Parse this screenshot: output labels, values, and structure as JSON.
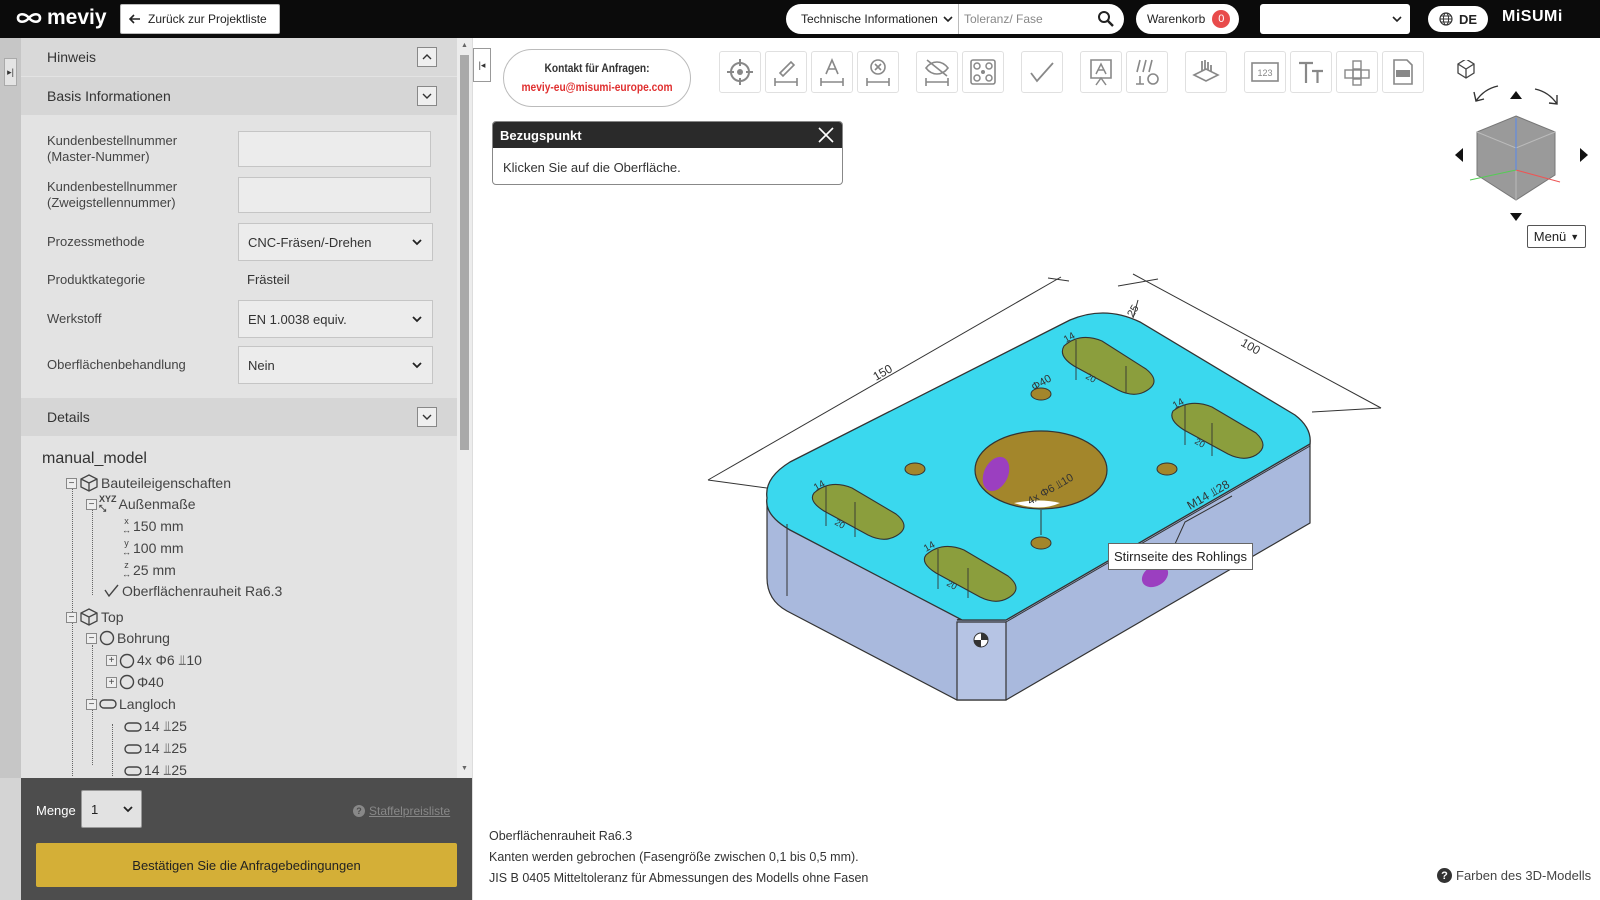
{
  "header": {
    "logo_text": "meviy",
    "back_button": "Zurück zur Projektliste",
    "search_category": "Technische Informationen",
    "search_placeholder": "Toleranz/ Fase",
    "cart_label": "Warenkorb",
    "cart_count": "0",
    "language": "DE",
    "brand": "MiSUMi"
  },
  "sidebar": {
    "hint_title": "Hinweis",
    "basis_title": "Basis Informationen",
    "fields": {
      "order_master_l1": "Kundenbestellnummer",
      "order_master_l2": "(Master-Nummer)",
      "order_branch_l1": "Kundenbestellnummer",
      "order_branch_l2": "(Zweigstellennummer)",
      "process_label": "Prozessmethode",
      "process_value": "CNC-Fräsen/-Drehen",
      "category_label": "Produktkategorie",
      "category_value": "Frästeil",
      "material_label": "Werkstoff",
      "material_value": "EN 1.0038 equiv.",
      "surface_label": "Oberflächenbehandlung",
      "surface_value": "Nein"
    },
    "details_title": "Details",
    "tree": {
      "root": "manual_model",
      "props": "Bauteileigenschaften",
      "dims": "Außenmaße",
      "dim_x": "150 mm",
      "dim_y": "100 mm",
      "dim_z": "25 mm",
      "roughness": "Oberflächenrauheit Ra6.3",
      "top": "Top",
      "bohrung": "Bohrung",
      "hole1": "4x Φ6 ⫫10",
      "hole2": "Φ40",
      "langloch": "Langloch",
      "slot1": "14 ⫫25",
      "slot2": "14 ⫫25",
      "slot3": "14 ⫫25"
    },
    "quantity_label": "Menge",
    "quantity_value": "1",
    "price_list_link": "Staffelpreisliste",
    "confirm_button": "Bestätigen Sie die Anfragebedingungen"
  },
  "viewer": {
    "contact_l1": "Kontakt für Anfragen:",
    "contact_l2": "meviy-eu@misumi-europe.com",
    "popup_title": "Bezugspunkt",
    "popup_text": "Klicken Sie auf die Oberfläche.",
    "tooltip": "Stirnseite des Rohlings",
    "menu_button": "Menü",
    "dimensions": {
      "length": "150",
      "width": "100",
      "height": "25",
      "hole_dia": "Φ40",
      "tapped": "M14 ⫫28",
      "small_hole": "4x Φ6 ⫫10",
      "slot_w": "14",
      "slot_d": "20"
    },
    "notes": [
      "Oberflächenrauheit Ra6.3",
      "Kanten werden gebrochen (Fasengröße zwischen 0,1 bis 0,5 mm).",
      "JIS B 0405 Mitteltoleranz für Abmessungen des Modells ohne Fasen"
    ],
    "colors_link": "Farben des 3D-Modells",
    "toolbar_icons": [
      "reference-point-icon",
      "measure-edge-icon",
      "measure-angle-icon",
      "delete-measure-icon",
      "hide-measure-icon",
      "hole-pattern-icon",
      "roughness-icon",
      "text-note-icon",
      "tolerance-icon",
      "hand-section-icon",
      "number-label-icon",
      "text-tool-icon",
      "views-icon",
      "pdf-export-icon"
    ]
  },
  "colors": {
    "top_face": "#3ad8ee",
    "side_face": "#a9b9dd",
    "slot": "#8b9e3d",
    "hole": "#a3862b",
    "accent": "#d4af37",
    "purple": "#9b3fc0"
  }
}
